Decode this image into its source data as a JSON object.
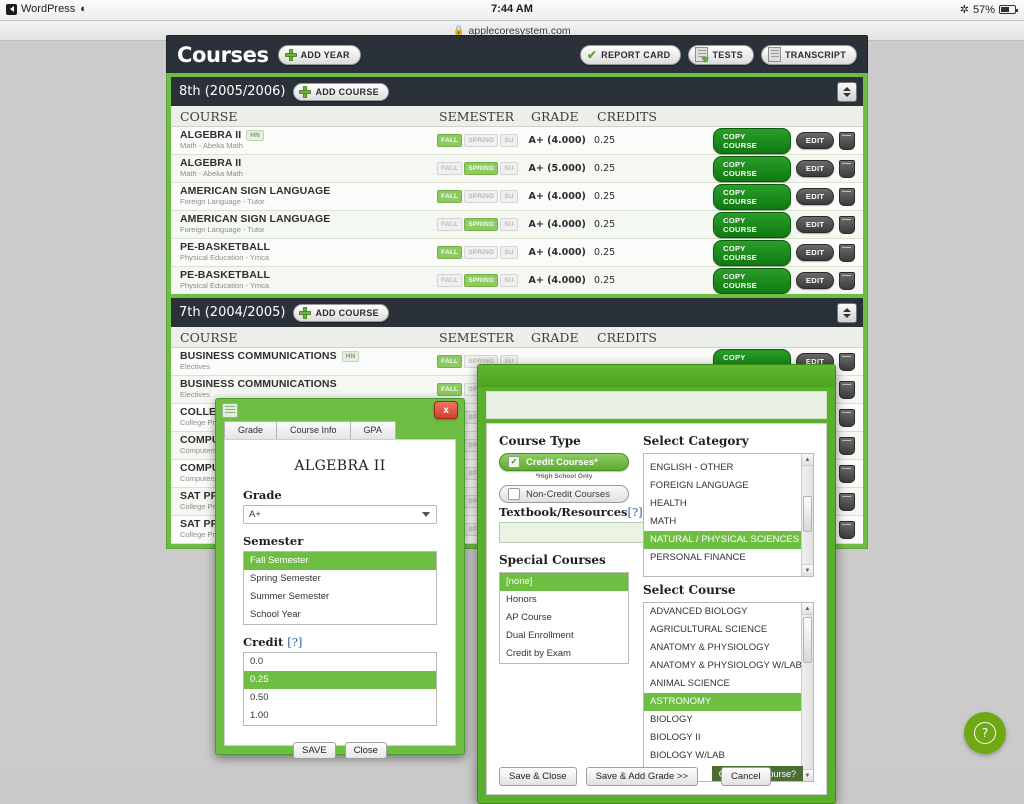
{
  "statusbar": {
    "app_label": "WordPress",
    "wifi_icon": "wifi-icon",
    "time": "7:44 AM",
    "bluetooth_icon": "bluetooth-icon",
    "battery_percent": "57%"
  },
  "urlbar": {
    "lock_icon": "lock-icon",
    "url": "applecoresystem.com"
  },
  "header": {
    "title": "Courses",
    "add_year_label": "ADD YEAR",
    "report_card_label": "REPORT CARD",
    "tests_label": "TESTS",
    "transcript_label": "TRANSCRIPT"
  },
  "table_headers": {
    "course": "COURSE",
    "semester": "SEMESTER",
    "grade": "GRADE",
    "credits": "CREDITS"
  },
  "row_actions": {
    "copy": "COPY COURSE",
    "edit": "EDIT",
    "delete_icon": "trash-icon"
  },
  "semester_tags": {
    "fall": "FALL",
    "spring": "SPRING",
    "summer": "SU"
  },
  "years": [
    {
      "label": "8th (2005/2006)",
      "add_course_label": "ADD COURSE",
      "rows": [
        {
          "name": "ALGEBRA II",
          "badge": "HN",
          "sub": "Math - Abeka Math",
          "fall": true,
          "spring": false,
          "summer": false,
          "grade": "A+ (4.000)",
          "credits": "0.25"
        },
        {
          "name": "ALGEBRA II",
          "badge": "",
          "sub": "Math - Abeka Math",
          "fall": false,
          "spring": true,
          "summer": false,
          "grade": "A+ (5.000)",
          "credits": "0.25"
        },
        {
          "name": "AMERICAN SIGN LANGUAGE",
          "badge": "",
          "sub": "Foreign Language - Tutor",
          "fall": true,
          "spring": false,
          "summer": false,
          "grade": "A+ (4.000)",
          "credits": "0.25"
        },
        {
          "name": "AMERICAN SIGN LANGUAGE",
          "badge": "",
          "sub": "Foreign Language - Tutor",
          "fall": false,
          "spring": true,
          "summer": false,
          "grade": "A+ (4.000)",
          "credits": "0.25"
        },
        {
          "name": "PE-BASKETBALL",
          "badge": "",
          "sub": "Physical Education - Ymca",
          "fall": true,
          "spring": false,
          "summer": false,
          "grade": "A+ (4.000)",
          "credits": "0.25"
        },
        {
          "name": "PE-BASKETBALL",
          "badge": "",
          "sub": "Physical Education - Ymca",
          "fall": false,
          "spring": true,
          "summer": false,
          "grade": "A+ (4.000)",
          "credits": "0.25"
        }
      ]
    },
    {
      "label": "7th (2004/2005)",
      "add_course_label": "ADD COURSE",
      "rows": [
        {
          "name": "BUSINESS COMMUNICATIONS",
          "badge": "HN",
          "sub": "Electives",
          "fall": true,
          "spring": false,
          "summer": false,
          "grade": "",
          "credits": ""
        },
        {
          "name": "BUSINESS COMMUNICATIONS",
          "badge": "",
          "sub": "Electives",
          "fall": true,
          "spring": false,
          "summer": false,
          "grade": "",
          "credits": ""
        },
        {
          "name": "COLLEGE PREP",
          "badge": "",
          "sub": "College Prep",
          "fall": true,
          "spring": false,
          "summer": false,
          "grade": "",
          "credits": ""
        },
        {
          "name": "COMPUTER SCIENCE",
          "badge": "",
          "sub": "Computers",
          "fall": true,
          "spring": false,
          "summer": false,
          "grade": "",
          "credits": ""
        },
        {
          "name": "COMPUTER SCIENCE",
          "badge": "",
          "sub": "Computers",
          "fall": true,
          "spring": false,
          "summer": false,
          "grade": "",
          "credits": ""
        },
        {
          "name": "SAT PREP",
          "badge": "",
          "sub": "College Prep",
          "fall": true,
          "spring": false,
          "summer": false,
          "grade": "",
          "credits": ""
        },
        {
          "name": "SAT PREP",
          "badge": "",
          "sub": "College Prep",
          "fall": true,
          "spring": false,
          "summer": false,
          "grade": "",
          "credits": ""
        }
      ]
    }
  ],
  "grade_dialog": {
    "close_label": "x",
    "tabs": [
      "Grade",
      "Course Info",
      "GPA"
    ],
    "course_title": "ALGEBRA II",
    "grade_label": "Grade",
    "grade_value": "A+",
    "semester_label": "Semester",
    "semester_options": [
      "Fall Semester",
      "Spring Semester",
      "Summer Semester",
      "School Year"
    ],
    "semester_selected": "Fall Semester",
    "credit_label": "Credit",
    "credit_help": "[?]",
    "credit_options": [
      "0.0",
      "0.25",
      "0.50",
      "1.00"
    ],
    "credit_selected": "0.25",
    "save_label": "SAVE",
    "close_button_label": "Close"
  },
  "course_dialog": {
    "course_type_label": "Course Type",
    "credit_courses_label": "Credit Courses*",
    "credit_courses_note": "*High School Only",
    "non_credit_courses_label": "Non-Credit Courses",
    "textbook_label": "Textbook/Resources",
    "textbook_help": "[?]",
    "textbook_value": "",
    "special_courses_label": "Special Courses",
    "special_courses_options": [
      "[none]",
      "Honors",
      "AP Course",
      "Dual Enrollment",
      "Credit by Exam"
    ],
    "special_courses_selected": "[none]",
    "select_category_label": "Select Category",
    "category_options": [
      "ENGLISH - OTHER",
      "FOREIGN LANGUAGE",
      "HEALTH",
      "MATH",
      "NATURAL / PHYSICAL SCIENCES",
      "PERSONAL FINANCE"
    ],
    "category_selected": "NATURAL / PHYSICAL SCIENCES",
    "select_course_label": "Select Course",
    "course_options": [
      "ADVANCED BIOLOGY",
      "AGRICULTURAL SCIENCE",
      "ANATOMY & PHYSIOLOGY",
      "ANATOMY & PHYSIOLOGY W/LAB",
      "ANIMAL SCIENCE",
      "ASTRONOMY",
      "BIOLOGY",
      "BIOLOGY II",
      "BIOLOGY W/LAB"
    ],
    "course_selected": "ASTRONOMY",
    "cant_find_label": "Can't Find Course?",
    "save_close_label": "Save & Close",
    "save_add_grade_label": "Save & Add Grade >>",
    "cancel_label": "Cancel"
  },
  "help_button": {
    "icon": "question-mark-icon"
  },
  "colors": {
    "brand_green": "#6fbe44",
    "dark_header": "#2b3138",
    "copy_green": "#1a8a1a",
    "help_green": "#6fa812"
  }
}
